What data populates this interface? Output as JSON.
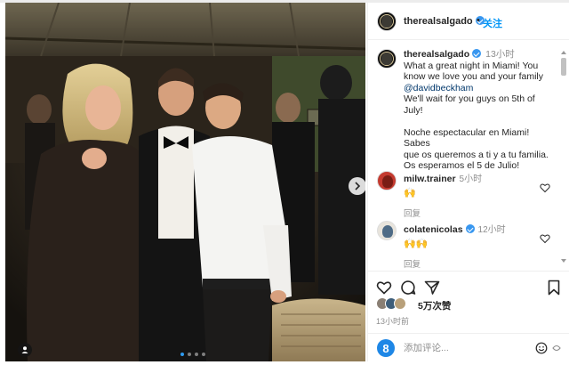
{
  "post": {
    "username": "therealsalgado",
    "follow_dot": "•",
    "follow_label": "关注",
    "caption": {
      "time": "13小时",
      "line1": "What a great night in Miami! You",
      "line2": "know we love you and your family",
      "mention": "@davidbeckham",
      "line4": "We'll wait for you guys on 5th of",
      "line5": "July!",
      "line6": "Noche espectacular en Miami! Sabes",
      "line7": "que os queremos a ti y a tu familia.",
      "line8": "Os esperamos el 5 de Julio!"
    }
  },
  "comments": [
    {
      "username": "milw.trainer",
      "time": "5小时",
      "body": "🙌",
      "reply_label": "回复"
    },
    {
      "username": "colatenicolas",
      "time": "12小时",
      "body": "🙌🙌",
      "reply_label": "回复"
    }
  ],
  "actions": {
    "likes": "5万次赞",
    "posted": "13小时前"
  },
  "composer": {
    "avatar_letter": "8",
    "placeholder": "添加评论..."
  },
  "carousel": {
    "slide": 1,
    "count": 4
  },
  "icons": {
    "header_avatar": "profile-avatar",
    "like": "heart-icon",
    "comment": "comment-icon",
    "share": "share-icon",
    "save": "bookmark-icon",
    "emoji": "emoji-icon",
    "tag": "person-tag-icon",
    "next": "chevron-right-icon"
  },
  "colors": {
    "accent": "#0095f6",
    "verified": "#3897f0",
    "mention": "#00376b",
    "muted": "#8e8e8e",
    "composer_avatar": "#1e87e6"
  }
}
